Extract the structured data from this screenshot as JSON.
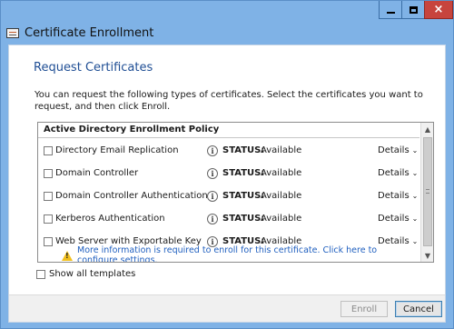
{
  "window": {
    "title": "Certificate Enrollment",
    "controls": {
      "minimize": "minimize-icon",
      "maximize": "maximize-icon",
      "close": "×"
    }
  },
  "page": {
    "heading": "Request Certificates",
    "intro": "You can request the following types of certificates. Select the certificates you want to request, and then click Enroll."
  },
  "policy": {
    "name": "Active Directory Enrollment Policy",
    "status_key": "STATUS:",
    "details_label": "Details",
    "templates": [
      {
        "name": "Directory Email Replication",
        "status": "Available",
        "checked": false
      },
      {
        "name": "Domain Controller",
        "status": "Available",
        "checked": false
      },
      {
        "name": "Domain Controller Authentication",
        "status": "Available",
        "checked": false
      },
      {
        "name": "Kerberos Authentication",
        "status": "Available",
        "checked": false
      },
      {
        "name": "Web Server with Exportable Key",
        "status": "Available",
        "checked": false
      }
    ],
    "warning": "More information is required to enroll for this certificate. Click here to configure settings."
  },
  "options": {
    "show_all_label": "Show all templates"
  },
  "buttons": {
    "enroll": "Enroll",
    "cancel": "Cancel"
  },
  "colors": {
    "accent": "#1f4e94",
    "link": "#1f5fbf",
    "titlebar": "#7fb2e6",
    "close": "#c7443d"
  }
}
